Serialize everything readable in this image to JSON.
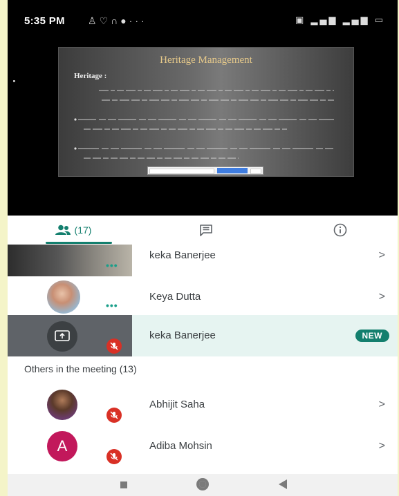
{
  "status_bar": {
    "time": "5:35 PM",
    "left_icons": [
      "notification-icon",
      "alarm-icon",
      "headset-icon",
      "whatsapp-icon",
      "more-icon"
    ],
    "right_icons": [
      "sim-icon",
      "signal-icon",
      "signal-icon",
      "battery-icon"
    ]
  },
  "presentation": {
    "title": "Heritage Management",
    "subtitle": "Heritage :"
  },
  "tabs": {
    "people_count": "(17)",
    "active": "people"
  },
  "participants": [
    {
      "name": "keka Banerjee",
      "avatar": "video-thumbnail",
      "status": "speaking"
    },
    {
      "name": "Keya Dutta",
      "avatar": "photo",
      "status": "speaking"
    },
    {
      "name": "keka Banerjee",
      "avatar": "screen-share",
      "status": "muted",
      "badge": "NEW"
    }
  ],
  "others": {
    "title": "Others in the meeting (13)",
    "items": [
      {
        "name": "Abhijit Saha",
        "avatar": "photo",
        "status": "muted"
      },
      {
        "name": "Adiba Mohsin",
        "avatar_letter": "A",
        "status": "muted"
      }
    ]
  },
  "colors": {
    "accent": "#137f6e",
    "highlight_row": "#e6f4f1",
    "new_badge": "#137f6e",
    "mute": "#d93025",
    "avatar_a": "#c2185b"
  }
}
